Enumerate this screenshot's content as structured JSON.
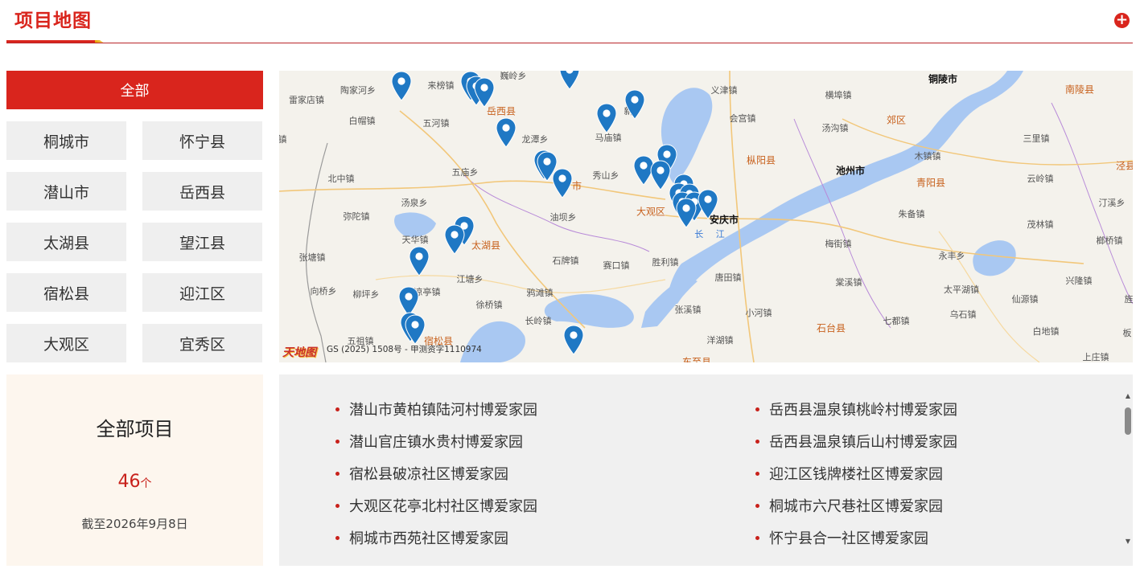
{
  "header": {
    "title": "项目地图",
    "more_icon": "plus-circle-icon"
  },
  "filters": {
    "all": "全部",
    "regions": [
      "桐城市",
      "怀宁县",
      "潜山市",
      "岳西县",
      "太湖县",
      "望江县",
      "宿松县",
      "迎江区",
      "大观区",
      "宜秀区"
    ]
  },
  "summary": {
    "title": "全部项目",
    "count": "46",
    "unit": "个",
    "date": "截至2026年9月8日"
  },
  "map": {
    "logo": "天地图",
    "copyright": "GS (2025) 1508号 - 甲测资字1110974",
    "accent_color": "#1f78c4",
    "labels": {
      "villages": [
        "雷家店镇",
        "陶家河乡",
        "来榜镇",
        "巍岭乡",
        "义津镇",
        "横埠镇",
        "白帽镇",
        "五河镇",
        "会宫镇",
        "汤沟镇",
        "龙潭乡",
        "马庙镇",
        "新",
        "木镇镇",
        "三里镇",
        "北中镇",
        "五庙乡",
        "秀山乡",
        "云岭镇",
        "汤泉乡",
        "油坝乡",
        "朱备镇",
        "汀溪乡",
        "弥陀镇",
        "茂林镇",
        "天华镇",
        "榔桥镇",
        "张塘镇",
        "石牌镇",
        "赛口镇",
        "胜利镇",
        "梅街镇",
        "永丰乡",
        "江塘乡",
        "唐田镇",
        "棠溪镇",
        "兴隆镇",
        "向桥乡",
        "柳坪乡",
        "凉亭镇",
        "鸦滩镇",
        "太平湖镇",
        "仙源镇",
        "徐桥镇",
        "张溪镇",
        "小河镇",
        "七都镇",
        "乌石镇",
        "五祖镇",
        "长岭镇",
        "洋湖镇",
        "白地镇",
        "上庄镇",
        "板",
        "旌",
        "镇",
        "东至县"
      ],
      "counties": [
        "岳西县",
        "枞阳县",
        "郊区",
        "南陵县",
        "青阳县",
        "泾县",
        "太湖县",
        "大观区",
        "宿松县",
        "石台县",
        "市"
      ],
      "cities": [
        "铜陵市",
        "池州市",
        "安庆市"
      ],
      "river": "长 江"
    }
  },
  "projects": [
    "潜山市黄柏镇陆河村博爱家园",
    "岳西县温泉镇桃岭村博爱家园",
    "潜山官庄镇水贵村博爱家园",
    "岳西县温泉镇后山村博爱家园",
    "宿松县破凉社区博爱家园",
    "迎江区钱牌楼社区博爱家园",
    "大观区花亭北村社区博爱家园",
    "桐城市六尺巷社区博爱家园",
    "桐城市西苑社区博爱家园",
    "怀宁县合一社区博爱家园"
  ],
  "list_scroll": {
    "up_icon": "triangle-up-icon",
    "down_icon": "triangle-down-icon"
  }
}
